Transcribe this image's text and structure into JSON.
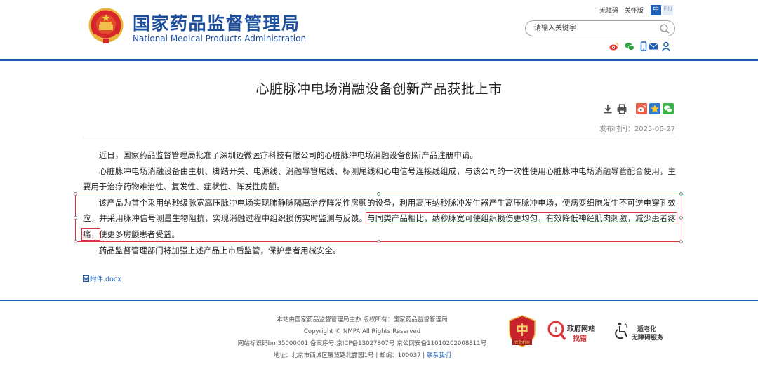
{
  "header": {
    "site_name_cn": "国家药品监督管理局",
    "site_name_en": "National Medical Products Administration",
    "top_links": [
      "无障碍",
      "关怀版"
    ],
    "lang": {
      "zh": "中",
      "en": "EN"
    },
    "search_placeholder": "请输入关键字",
    "social_icons": [
      "weibo-icon",
      "wechat-icon",
      "mobile-icon",
      "mail-icon",
      "user-icon"
    ],
    "accent_color": "#1d5fb8"
  },
  "article": {
    "title": "心脏脉冲电场消融设备创新产品获批上市",
    "tools": [
      "download-icon",
      "print-icon",
      "share-weibo-icon",
      "share-qzone-icon",
      "share-wechat-icon"
    ],
    "publish_time": "发布时间：2025-06-27",
    "paragraphs": {
      "p1": "近日，国家药品监督管理局批准了深圳迈微医疗科技有限公司的心脏脉冲电场消融设备创新产品注册申请。",
      "p2": "心脏脉冲电场消融设备由主机、脚踏开关、电源线、消融导管尾线、标测尾线和心电信号连接线组成，与该公司的一次性使用心脏脉冲电场消融导管配合使用，主要用于治疗药物难治性、复发性、症状性、阵发性房颤。",
      "p3_a": "该产品为首个采用纳秒级脉宽高压脉冲电场实现肺静脉隔离治疗阵发性房颤的设备，利用高压纳秒脉冲发生器产生高压脉冲电场，使病变细胞发生不可逆电穿孔效应，并采用脉冲信号测量生物阻抗，实现消融过程中组织损伤实时监测与反馈。",
      "p3_b": "与同类产品相比，纳秒脉宽可使组织损伤更均匀，有效降低神经肌肉刺激，减少患者疼痛，",
      "p3_c": "使更多房颤患者受益。",
      "p4": "药品监督管理部门将加强上述产品上市后监管，保护患者用械安全。"
    },
    "attachment": "附件.docx"
  },
  "footer": {
    "line1": "本站由国家药品监督管理局主办 版权所有：国家药品监督管理局",
    "line2": "Copyright © NMPA All Rights Reserved",
    "line3": "网站标识码bm35000001    备案序号:京ICP备13027807号    京公网安备11010202008311号",
    "line4_address": "地址：北京市西城区展览路北露园1号 | 邮编：100037 | ",
    "line4_contact": "联系我们",
    "badge_org": "党政机关",
    "badge_gov_title": "政府网站",
    "badge_gov_sub": "找错",
    "badge_care_title": "适老化",
    "badge_care_sub": "无障碍服务",
    "brand_red": "#d9343a"
  }
}
